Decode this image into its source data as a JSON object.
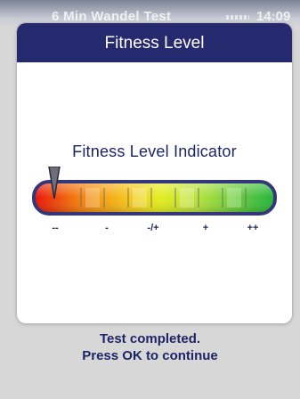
{
  "background_window": {
    "title": "6 Min Wandel Test",
    "time": "14:09"
  },
  "dialog": {
    "title": "Fitness Level",
    "indicator_label": "Fitness Level Indicator",
    "level_ticks": [
      "--",
      "-",
      "-/+",
      "+",
      "++"
    ],
    "selected_level": "--",
    "gradient_colors": [
      "#e8120a",
      "#f47b0d",
      "#f6c21b",
      "#e5ec1f",
      "#b6e23c",
      "#68cc3c",
      "#22b43c"
    ],
    "bar_border_color": "#343878",
    "pointer_icon": "down-pointer-icon"
  },
  "footer": {
    "line1": "Test completed.",
    "line2": "Press OK to continue"
  }
}
